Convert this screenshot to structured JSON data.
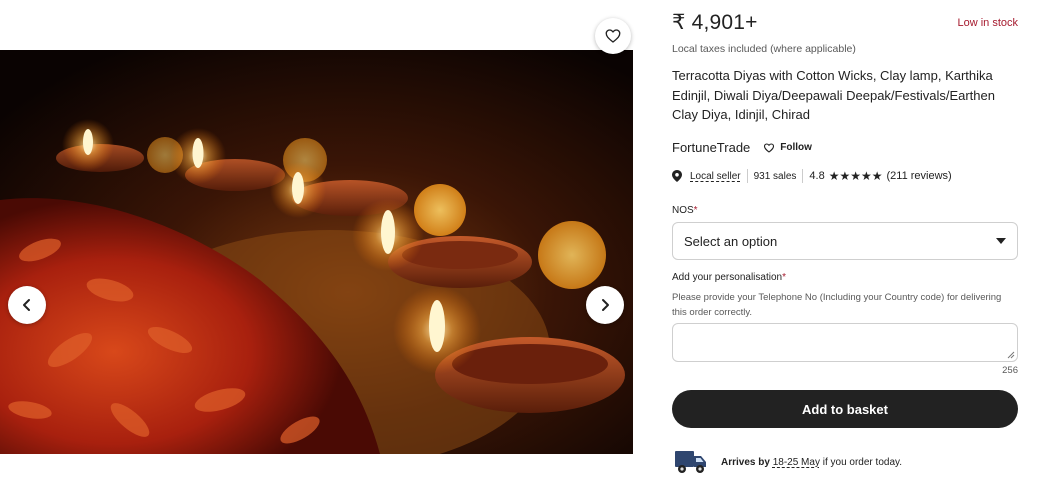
{
  "listing": {
    "price": "₹ 4,901+",
    "stock_status": "Low in stock",
    "tax_note": "Local taxes included (where applicable)",
    "title": "Terracotta Diyas with Cotton Wicks, Clay lamp, Karthika Edinjil, Diwali Diya/Deepawali Deepak/Festivals/Earthen Clay Diya, Idinjil, Chirad"
  },
  "shop": {
    "name": "FortuneTrade",
    "follow_label": "Follow",
    "local_seller": "Local seller",
    "sales": "931 sales",
    "rating": "4.8",
    "stars": "★★★★★",
    "reviews": "(211 reviews)"
  },
  "options": {
    "nos_label": "NOS",
    "nos_placeholder": "Select an option",
    "personalisation_label": "Add your personalisation",
    "personalisation_hint": "Please provide your Telephone No (Including your Country code) for delivering this order correctly.",
    "char_count": "256",
    "required_mark": "*"
  },
  "actions": {
    "add_to_basket": "Add to basket"
  },
  "shipping": {
    "prefix": "Arrives by",
    "dates": "18-25 May",
    "suffix": "if you order today."
  },
  "icons": {
    "favorite": "heart-icon",
    "prev": "chevron-left-icon",
    "next": "chevron-right-icon",
    "location": "map-pin-icon",
    "dropdown": "caret-down-icon",
    "delivery": "truck-icon"
  },
  "colors": {
    "stock": "#a61a2e",
    "button": "#222222",
    "truck": "#2f466f"
  }
}
